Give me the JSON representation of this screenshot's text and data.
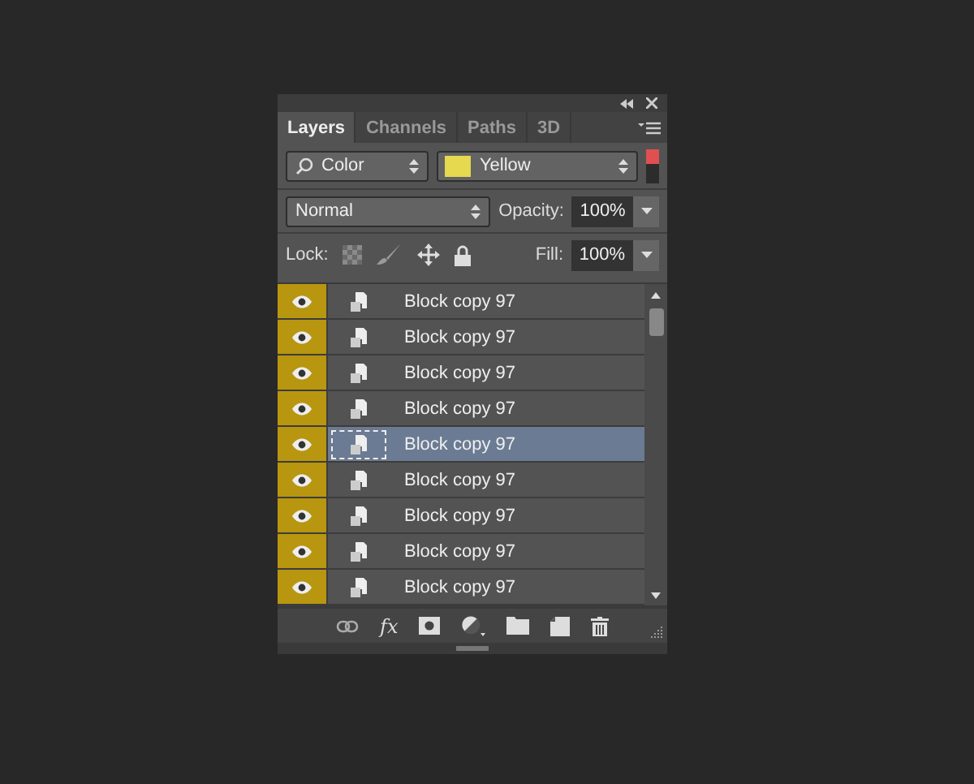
{
  "tabs": [
    {
      "label": "Layers",
      "selected": true
    },
    {
      "label": "Channels",
      "selected": false
    },
    {
      "label": "Paths",
      "selected": false
    },
    {
      "label": "3D",
      "selected": false
    }
  ],
  "filter": {
    "kind_value": "Color",
    "color_value": "Yellow",
    "color": "#e6d84f",
    "filter_on": true
  },
  "blend": {
    "mode": "Normal",
    "opacity_label": "Opacity:",
    "opacity": "100%"
  },
  "lock": {
    "label": "Lock:",
    "fill_label": "Fill:",
    "fill": "100%"
  },
  "layers": [
    {
      "name": "Block copy 97",
      "visible": true,
      "color": "#b8960f",
      "selected": false
    },
    {
      "name": "Block copy 97",
      "visible": true,
      "color": "#b8960f",
      "selected": false
    },
    {
      "name": "Block copy 97",
      "visible": true,
      "color": "#b8960f",
      "selected": false
    },
    {
      "name": "Block copy 97",
      "visible": true,
      "color": "#b8960f",
      "selected": false
    },
    {
      "name": "Block copy 97",
      "visible": true,
      "color": "#b8960f",
      "selected": true
    },
    {
      "name": "Block copy 97",
      "visible": true,
      "color": "#b8960f",
      "selected": false
    },
    {
      "name": "Block copy 97",
      "visible": true,
      "color": "#b8960f",
      "selected": false
    },
    {
      "name": "Block copy 97",
      "visible": true,
      "color": "#b8960f",
      "selected": false
    },
    {
      "name": "Block copy 97",
      "visible": true,
      "color": "#b8960f",
      "selected": false
    }
  ],
  "toolbar": {
    "fx_label": "fx"
  }
}
